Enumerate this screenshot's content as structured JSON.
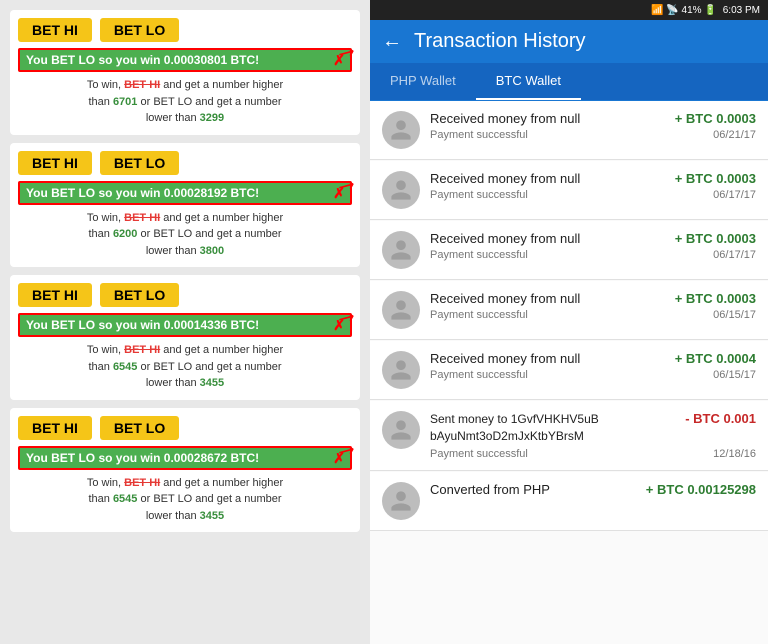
{
  "left": {
    "cards": [
      {
        "bet_hi": "BET HI",
        "bet_lo": "BET LO",
        "win_text": "You BET LO so you win 0.00030801 BTC!",
        "info_line1": "To win,",
        "info_hi": "BET HI",
        "info_and": "and get a number higher",
        "info_than_hi": "than",
        "hi_number": "6701",
        "info_or": "or BET LO and get a number",
        "info_lower": "lower than",
        "lo_number": "3299"
      },
      {
        "bet_hi": "BET HI",
        "bet_lo": "BET LO",
        "win_text": "You BET LO so you win 0.00028192 BTC!",
        "info_line1": "To win,",
        "info_hi": "BET HI",
        "info_and": "and get a number higher",
        "info_than_hi": "than",
        "hi_number": "6200",
        "info_or": "or BET LO and get a number",
        "info_lower": "lower than",
        "lo_number": "3800"
      },
      {
        "bet_hi": "BET HI",
        "bet_lo": "BET LO",
        "win_text": "You BET LO so you win 0.00014336 BTC!",
        "info_line1": "To win,",
        "info_hi": "BET HI",
        "info_and": "and get a number higher",
        "info_than_hi": "than",
        "hi_number": "6545",
        "info_or": "or BET LO and get a number",
        "info_lower": "lower than",
        "lo_number": "3455"
      },
      {
        "bet_hi": "BET HI",
        "bet_lo": "BET LO",
        "win_text": "You BET LO so you win 0.00028672 BTC!",
        "info_line1": "To win,",
        "info_hi": "BET HI",
        "info_and": "and get a number higher",
        "info_than_hi": "than",
        "hi_number": "6545",
        "info_or": "or BET LO and get a number",
        "info_lower": "lower than",
        "lo_number": "3455"
      }
    ]
  },
  "right": {
    "status_bar": {
      "icons": "📶 📡 41% 🔋",
      "time": "6:03 PM"
    },
    "header": {
      "back_label": "←",
      "title": "Transaction History"
    },
    "tabs": [
      {
        "label": "PHP Wallet",
        "active": false
      },
      {
        "label": "BTC Wallet",
        "active": true
      }
    ],
    "transactions": [
      {
        "title": "Received money from null",
        "amount": "+ BTC 0.0003",
        "status": "Payment successful",
        "date": "06/21/17",
        "type": "positive"
      },
      {
        "title": "Received money from null",
        "amount": "+ BTC 0.0003",
        "status": "Payment successful",
        "date": "06/17/17",
        "type": "positive"
      },
      {
        "title": "Received money from null",
        "amount": "+ BTC 0.0003",
        "status": "Payment successful",
        "date": "06/17/17",
        "type": "positive"
      },
      {
        "title": "Received money from null",
        "amount": "+ BTC 0.0003",
        "status": "Payment successful",
        "date": "06/15/17",
        "type": "positive"
      },
      {
        "title": "Received money from null",
        "amount": "+ BTC 0.0004",
        "status": "Payment successful",
        "date": "06/15/17",
        "type": "positive"
      },
      {
        "title": "Sent money to 1GvfVHKHV5uB\nbAyuNmt3oD2mJxKtbYBrsM",
        "amount": "- BTC 0.001",
        "status": "Payment successful",
        "date": "12/18/16",
        "type": "negative"
      },
      {
        "title": "Converted from PHP",
        "amount": "+ BTC 0.00125298",
        "status": "",
        "date": "",
        "type": "positive"
      }
    ]
  }
}
